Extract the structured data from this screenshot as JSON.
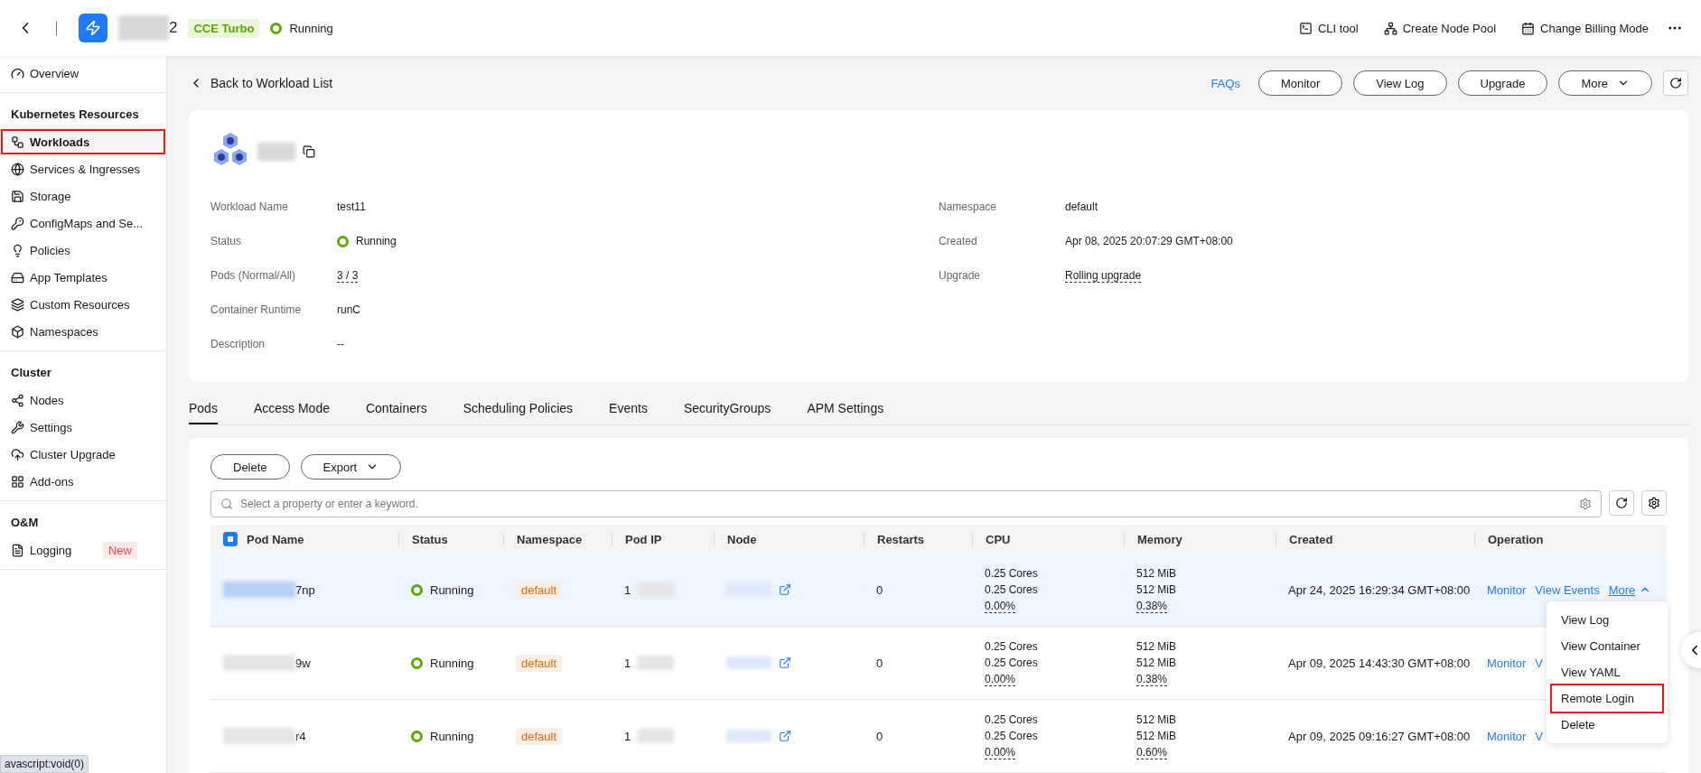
{
  "header": {
    "cluster_name_suffix": "2",
    "badge": "CCE Turbo",
    "status": "Running",
    "actions": [
      {
        "label": "CLI tool"
      },
      {
        "label": "Create Node Pool"
      },
      {
        "label": "Change Billing Mode"
      }
    ]
  },
  "sidebar": {
    "sections": [
      {
        "items": [
          {
            "label": "Overview",
            "selected": false,
            "highlighted": false
          }
        ]
      },
      {
        "title": "Kubernetes Resources",
        "items": [
          {
            "label": "Workloads",
            "selected": true,
            "highlighted": true
          },
          {
            "label": "Services & Ingresses",
            "selected": false,
            "highlighted": false
          },
          {
            "label": "Storage",
            "selected": false,
            "highlighted": false
          },
          {
            "label": "ConfigMaps and Se...",
            "selected": false,
            "highlighted": false
          },
          {
            "label": "Policies",
            "selected": false,
            "highlighted": false
          },
          {
            "label": "App Templates",
            "selected": false,
            "highlighted": false
          },
          {
            "label": "Custom Resources",
            "selected": false,
            "highlighted": false
          },
          {
            "label": "Namespaces",
            "selected": false,
            "highlighted": false
          }
        ]
      },
      {
        "title": "Cluster",
        "items": [
          {
            "label": "Nodes",
            "selected": false,
            "highlighted": false
          },
          {
            "label": "Settings",
            "selected": false,
            "highlighted": false
          },
          {
            "label": "Cluster Upgrade",
            "selected": false,
            "highlighted": false
          },
          {
            "label": "Add-ons",
            "selected": false,
            "highlighted": false
          }
        ]
      },
      {
        "title": "O&M",
        "items": [
          {
            "label": "Logging",
            "selected": false,
            "highlighted": false,
            "badge": "New"
          }
        ]
      }
    ]
  },
  "breadcrumb": "Back to Workload List",
  "toolbar": {
    "link": "FAQs",
    "buttons": [
      {
        "label": "Monitor"
      },
      {
        "label": "View Log"
      },
      {
        "label": "Upgrade"
      },
      {
        "label": "More",
        "dropdown": true
      }
    ]
  },
  "details": {
    "left": [
      {
        "label": "Workload Name",
        "value": "test11",
        "kind": "text"
      },
      {
        "label": "Status",
        "value": "Running",
        "kind": "status"
      },
      {
        "label": "Pods (Normal/All)",
        "value": "3 / 3",
        "kind": "dashed"
      },
      {
        "label": "Container Runtime",
        "value": "runC",
        "kind": "text"
      },
      {
        "label": "Description",
        "value": "--",
        "kind": "text"
      }
    ],
    "right": [
      {
        "label": "Namespace",
        "value": "default",
        "kind": "text"
      },
      {
        "label": "Created",
        "value": "Apr 08, 2025 20:07:29 GMT+08:00",
        "kind": "text"
      },
      {
        "label": "Upgrade",
        "value": "Rolling upgrade",
        "kind": "dashed"
      }
    ]
  },
  "tabs": [
    {
      "label": "Pods",
      "selected": true
    },
    {
      "label": "Access Mode",
      "selected": false
    },
    {
      "label": "Containers",
      "selected": false
    },
    {
      "label": "Scheduling Policies",
      "selected": false
    },
    {
      "label": "Events",
      "selected": false
    },
    {
      "label": "SecurityGroups",
      "selected": false
    },
    {
      "label": "APM Settings",
      "selected": false
    }
  ],
  "pods": {
    "buttons": [
      {
        "label": "Delete",
        "dropdown": false
      },
      {
        "label": "Export",
        "dropdown": true
      }
    ],
    "search": {
      "placeholder": "Select a property or enter a keyword."
    },
    "select_all": {
      "indeterminate": true
    },
    "columns": [
      "Pod Name",
      "Status",
      "Namespace",
      "Pod IP",
      "Node",
      "Restarts",
      "CPU",
      "Memory",
      "Created",
      "Operation"
    ],
    "rows": [
      {
        "selected": true,
        "pod_name": "7np",
        "status": "Running",
        "namespace": "default",
        "pod_ip": "1",
        "restarts": "0",
        "cpu": [
          "0.25 Cores",
          "0.25 Cores",
          "0.00%"
        ],
        "memory": [
          "512 MiB",
          "512 MiB",
          "0.38%"
        ],
        "created": "Apr 24, 2025 16:29:34 GMT+08:00",
        "operations": [
          {
            "label": "Monitor"
          },
          {
            "label": "View Events"
          },
          {
            "label": "More",
            "expanded": true
          }
        ]
      },
      {
        "selected": false,
        "pod_name": "9w",
        "status": "Running",
        "namespace": "default",
        "pod_ip": "1",
        "restarts": "0",
        "cpu": [
          "0.25 Cores",
          "0.25 Cores",
          "0.00%"
        ],
        "memory": [
          "512 MiB",
          "512 MiB",
          "0.38%"
        ],
        "created": "Apr 09, 2025 14:43:30 GMT+08:00",
        "operations": [
          {
            "label": "Monitor"
          },
          {
            "label": "V"
          }
        ]
      },
      {
        "selected": false,
        "pod_name": "r4",
        "status": "Running",
        "namespace": "default",
        "pod_ip": "1",
        "restarts": "0",
        "cpu": [
          "0.25 Cores",
          "0.25 Cores",
          "0.00%"
        ],
        "memory": [
          "512 MiB",
          "512 MiB",
          "0.60%"
        ],
        "created": "Apr 09, 2025 09:16:27 GMT+08:00",
        "operations": [
          {
            "label": "Monitor"
          },
          {
            "label": "V"
          }
        ]
      }
    ],
    "menu": [
      {
        "label": "View Log",
        "highlighted": false
      },
      {
        "label": "View Container",
        "highlighted": false
      },
      {
        "label": "View YAML",
        "highlighted": false
      },
      {
        "label": "Remote Login",
        "highlighted": true
      },
      {
        "label": "Delete",
        "highlighted": false
      }
    ]
  },
  "status_bar": "avascript:void(0)"
}
